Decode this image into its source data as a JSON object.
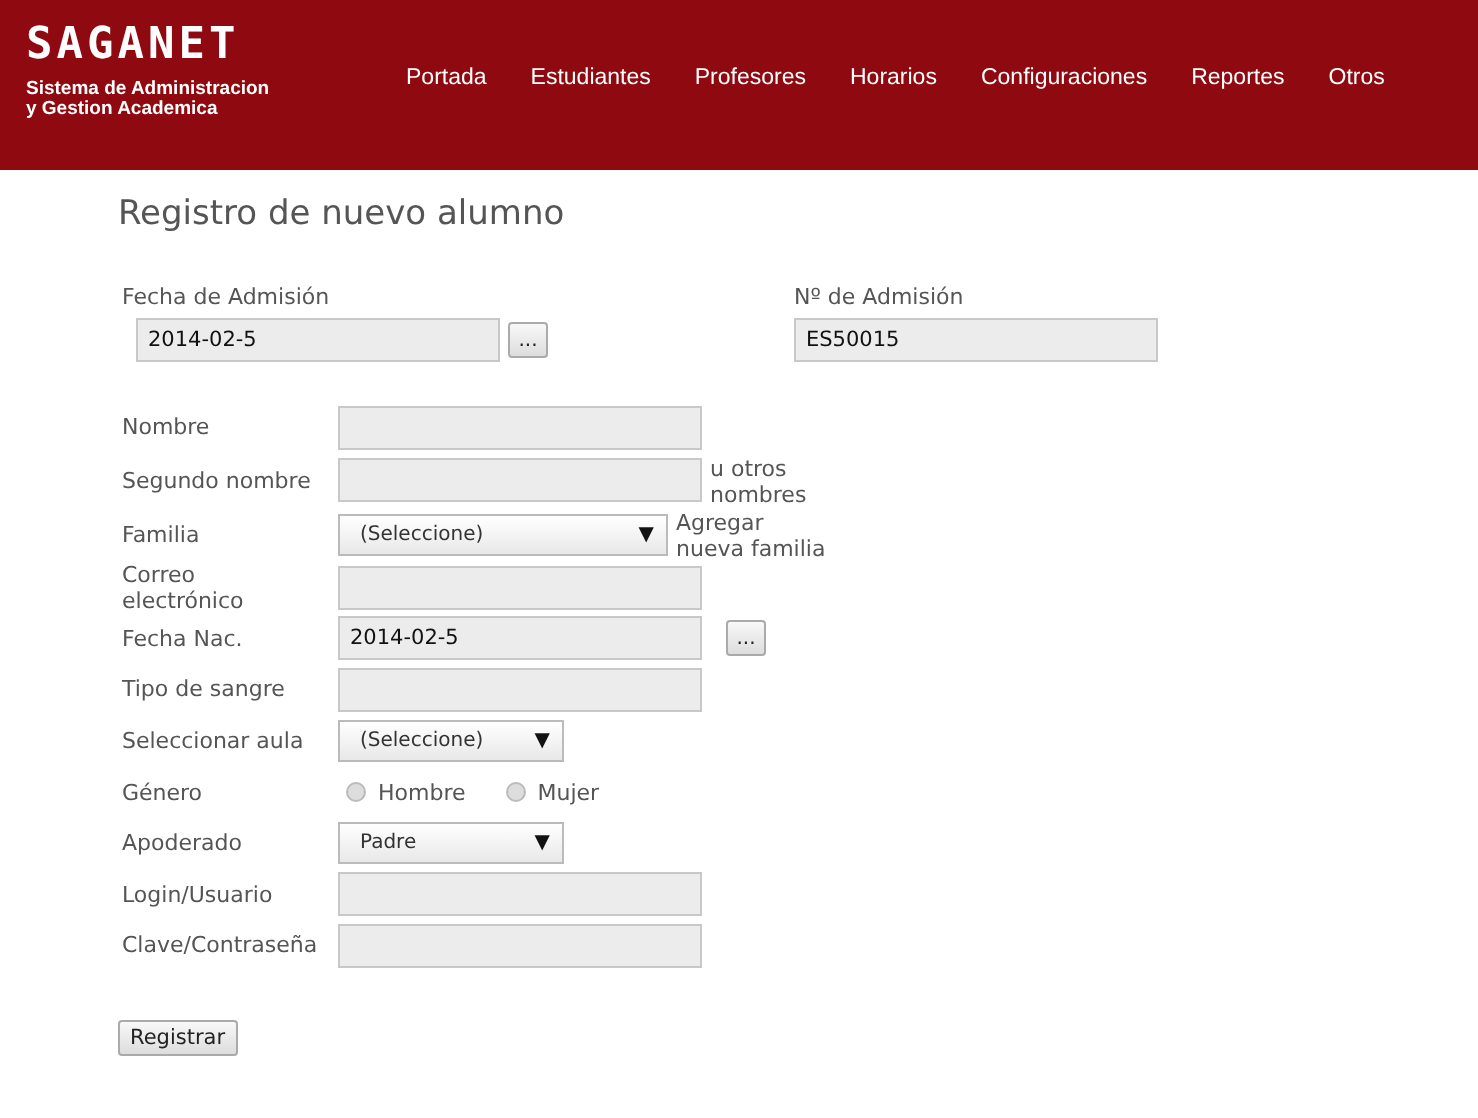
{
  "header": {
    "logo": "SAGANET",
    "subtitle_lines": [
      "Sistema de Administracion",
      "y Gestion Academica"
    ],
    "nav": [
      "Portada",
      "Estudiantes",
      "Profesores",
      "Horarios",
      "Configuraciones",
      "Reportes",
      "Otros"
    ]
  },
  "title": "Registro de nuevo alumno",
  "admission": {
    "date_label": "Fecha de Admisión",
    "date_value": "2014-02-5",
    "date_button": "...",
    "number_label": "Nº de Admisión",
    "number_value": "ES50015"
  },
  "rows": [
    {
      "kind": "text",
      "label": "Nombre"
    },
    {
      "kind": "text",
      "label": "Segundo nombre",
      "note": "u otros nombres"
    },
    {
      "kind": "select",
      "label": "Familia",
      "value": "(Seleccione)",
      "arrow": "▼",
      "note": "Agregar nueva familia"
    },
    {
      "kind": "text",
      "label": "Correo electrónico"
    },
    {
      "kind": "date",
      "label": "Fecha Nac.",
      "value": "2014-02-5",
      "button": "..."
    },
    {
      "kind": "text",
      "label": "Tipo de sangre"
    },
    {
      "kind": "shortselect",
      "label": "Seleccionar aula",
      "value": "(Seleccione)",
      "arrow": "▼"
    },
    {
      "kind": "radio",
      "label": "Género",
      "options": [
        {
          "label": "Hombre",
          "selected": false
        },
        {
          "label": "Mujer",
          "selected": false
        }
      ]
    },
    {
      "kind": "shortselect",
      "label": "Apoderado",
      "value": "Padre",
      "arrow": "▼"
    },
    {
      "kind": "text",
      "label": "Login/Usuario"
    },
    {
      "kind": "text",
      "label": "Clave/Contraseña"
    }
  ],
  "submit": "Registrar"
}
